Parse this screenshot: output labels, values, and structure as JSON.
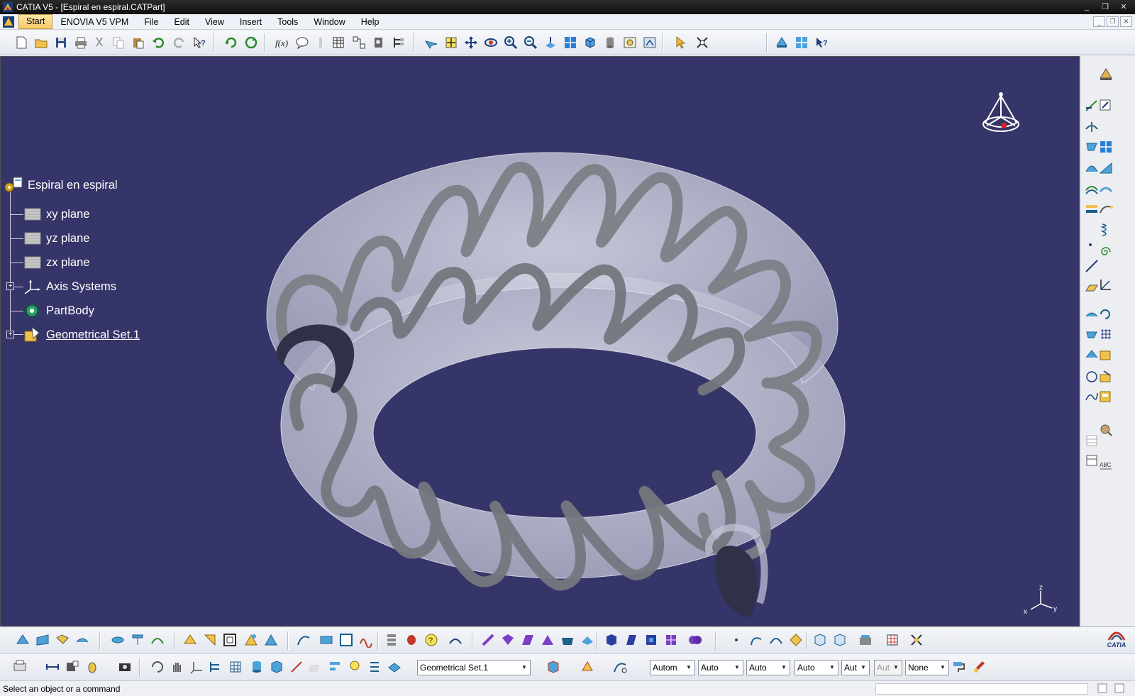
{
  "window": {
    "title": "CATIA V5 - [Espiral en espiral.CATPart]",
    "buttons": [
      "_",
      "❐",
      "✕"
    ]
  },
  "menubar": {
    "items": [
      "Start",
      "ENOVIA V5 VPM",
      "File",
      "Edit",
      "View",
      "Insert",
      "Tools",
      "Window",
      "Help"
    ],
    "doc_buttons": [
      "_",
      "❐",
      "✕"
    ]
  },
  "tree": {
    "root": "Espiral en espiral",
    "children": [
      "xy plane",
      "yz plane",
      "zx plane",
      "Axis Systems",
      "PartBody",
      "Geometrical Set.1"
    ]
  },
  "compass": {
    "axes": [
      "x",
      "y",
      "z"
    ]
  },
  "bottom_toolbar": {
    "current_set": "Geometrical Set.1",
    "graphic_props": [
      "Autom",
      "Auto",
      "Auto",
      "Auto",
      "Aut",
      "Aut",
      "None"
    ]
  },
  "status": {
    "message": "Select an object or a command"
  },
  "brand": {
    "logo_text": "CATIA"
  },
  "colors": {
    "viewport_bg": "#363569",
    "tube": "#c5c7da",
    "spring": "#7d7f86"
  }
}
